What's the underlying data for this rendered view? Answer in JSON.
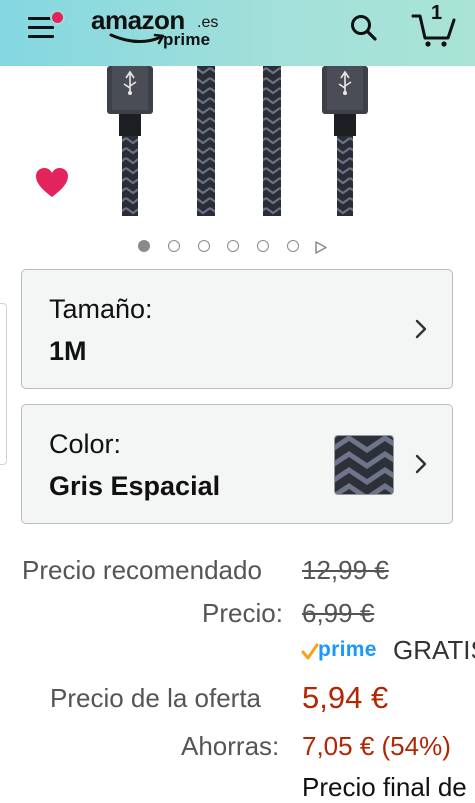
{
  "header": {
    "logo_word": "amazon",
    "logo_tld": ".es",
    "logo_prime": "prime",
    "cart_count": "1"
  },
  "carousel": {
    "total_dots": 6,
    "active_index": 0
  },
  "variations": {
    "size": {
      "label": "Tamaño:",
      "value": "1M"
    },
    "color": {
      "label": "Color:",
      "value": "Gris Espacial"
    }
  },
  "pricing": {
    "recommended_label": "Precio recomendado",
    "recommended_value": "12,99 €",
    "price_label": "Precio:",
    "price_value": "6,99 €",
    "prime_label": "prime",
    "shipping_text": "GRATIS",
    "offer_label": "Precio de la oferta",
    "offer_value": "5,94 €",
    "savings_label": "Ahorras:",
    "savings_value": "7,05 € (54%)",
    "final_text": "Precio final de"
  },
  "colors": {
    "header_gradient_start": "#84d7e1",
    "header_gradient_end": "#a9e4d6",
    "wishlist_heart": "#e3235b",
    "price_red": "#b12704",
    "prime_blue": "#1a98ff",
    "prime_check": "#f7a21b"
  },
  "icons": {
    "menu": "hamburger-menu-icon",
    "search": "search-icon",
    "cart": "cart-icon",
    "wishlist": "heart-icon",
    "chevron": "chevron-right-icon",
    "carousel_play": "play-triangle-icon"
  }
}
